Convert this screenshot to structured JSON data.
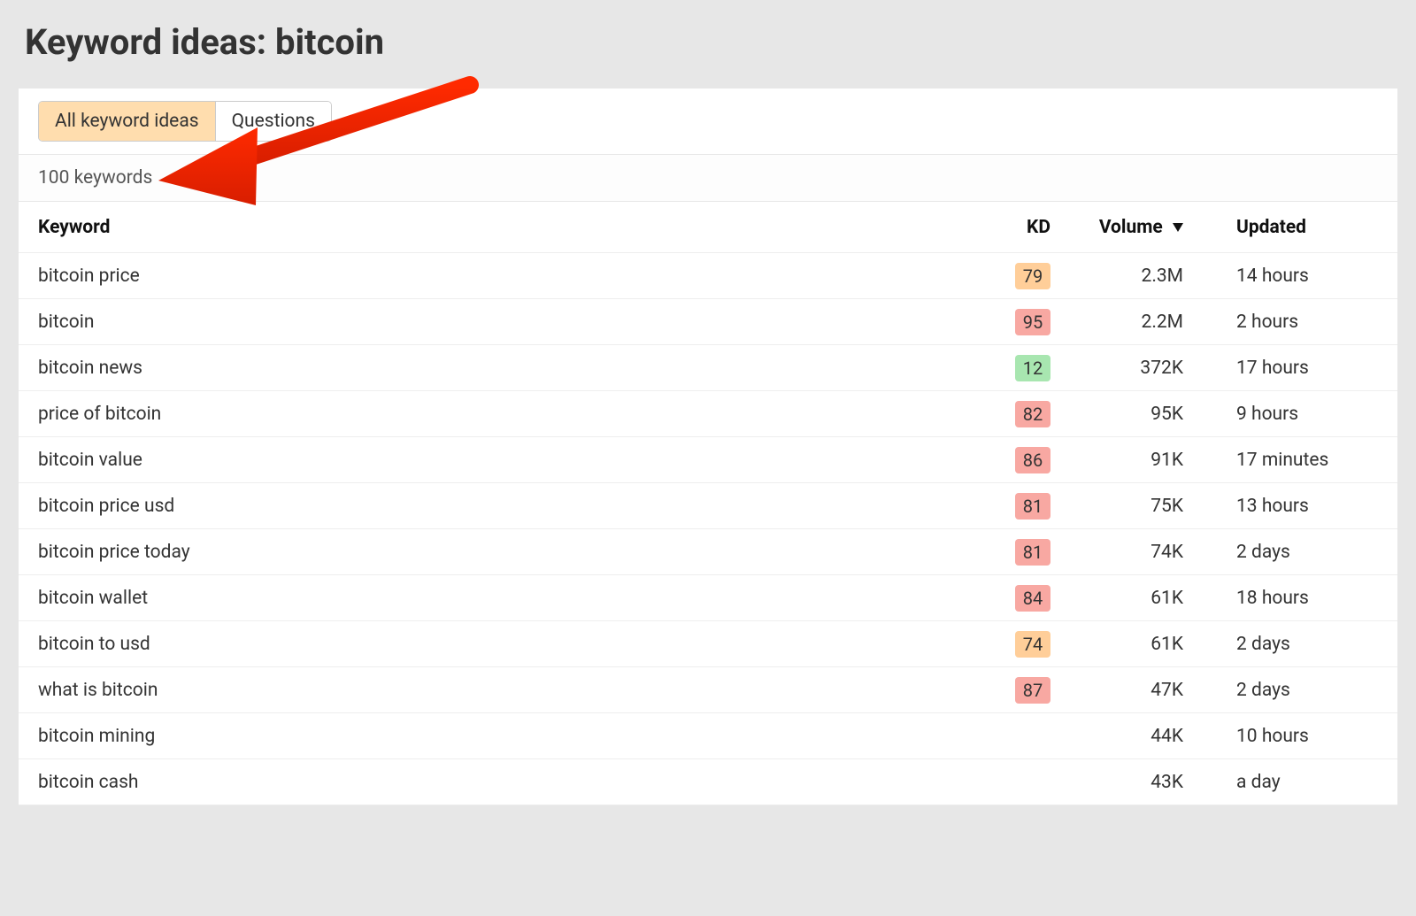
{
  "title": "Keyword ideas: bitcoin",
  "tabs": {
    "all": "All keyword ideas",
    "questions": "Questions"
  },
  "summary": "100 keywords",
  "columns": {
    "keyword": "Keyword",
    "kd": "KD",
    "volume": "Volume",
    "updated": "Updated"
  },
  "rows": [
    {
      "keyword": "bitcoin price",
      "kd": "79",
      "kd_tier": "orange",
      "volume": "2.3M",
      "updated": "14 hours"
    },
    {
      "keyword": "bitcoin",
      "kd": "95",
      "kd_tier": "red",
      "volume": "2.2M",
      "updated": "2 hours"
    },
    {
      "keyword": "bitcoin news",
      "kd": "12",
      "kd_tier": "green",
      "volume": "372K",
      "updated": "17 hours"
    },
    {
      "keyword": "price of bitcoin",
      "kd": "82",
      "kd_tier": "red",
      "volume": "95K",
      "updated": "9 hours"
    },
    {
      "keyword": "bitcoin value",
      "kd": "86",
      "kd_tier": "red",
      "volume": "91K",
      "updated": "17 minutes"
    },
    {
      "keyword": "bitcoin price usd",
      "kd": "81",
      "kd_tier": "red",
      "volume": "75K",
      "updated": "13 hours"
    },
    {
      "keyword": "bitcoin price today",
      "kd": "81",
      "kd_tier": "red",
      "volume": "74K",
      "updated": "2 days"
    },
    {
      "keyword": "bitcoin wallet",
      "kd": "84",
      "kd_tier": "red",
      "volume": "61K",
      "updated": "18 hours"
    },
    {
      "keyword": "bitcoin to usd",
      "kd": "74",
      "kd_tier": "orange",
      "volume": "61K",
      "updated": "2 days"
    },
    {
      "keyword": "what is bitcoin",
      "kd": "87",
      "kd_tier": "red",
      "volume": "47K",
      "updated": "2 days"
    },
    {
      "keyword": "bitcoin mining",
      "kd": "",
      "kd_tier": "",
      "volume": "44K",
      "updated": "10 hours"
    },
    {
      "keyword": "bitcoin cash",
      "kd": "",
      "kd_tier": "",
      "volume": "43K",
      "updated": "a day"
    }
  ]
}
